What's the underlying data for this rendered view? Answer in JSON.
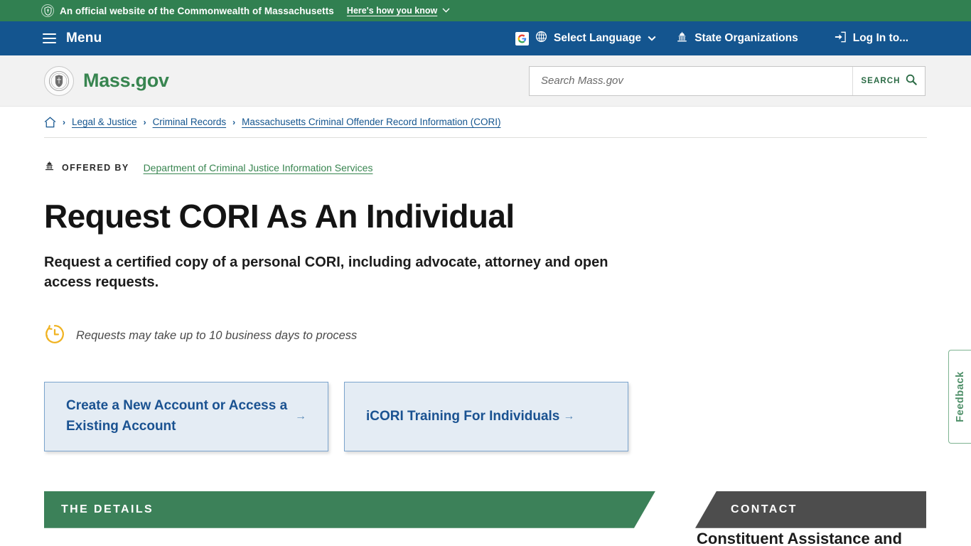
{
  "official_banner": {
    "seal_icon": "state-seal-icon",
    "text": "An official website of the Commonwealth of Massachusetts",
    "how_you_know_label": "Here's how you know",
    "chevron_icon": "chevron-down-icon",
    "background_color": "#318051"
  },
  "main_nav": {
    "menu_icon": "hamburger-icon",
    "menu_label": "Menu",
    "background_color": "#14558f",
    "items": [
      {
        "label": "Select Language",
        "icons": [
          "google-translate-icon",
          "globe-icon"
        ],
        "trailing_icon": "chevron-down-icon"
      },
      {
        "label": "State Organizations",
        "icons": [
          "capitol-dome-icon"
        ]
      },
      {
        "label": "Log In to...",
        "icons": [
          "sign-in-icon"
        ]
      }
    ]
  },
  "header": {
    "logo_seal_icon": "mass-state-seal-icon",
    "wordmark": "Mass.gov",
    "wordmark_color": "#388550",
    "background_color": "#f2f2f2"
  },
  "search": {
    "placeholder": "Search Mass.gov",
    "value": "",
    "button_label": "SEARCH",
    "button_icon": "magnifier-icon"
  },
  "breadcrumb": {
    "home_icon": "home-icon",
    "separator": "›",
    "items": [
      {
        "label": "Legal & Justice"
      },
      {
        "label": "Criminal Records"
      },
      {
        "label": "Massachusetts Criminal Offender Record Information (CORI)"
      }
    ]
  },
  "offered_by": {
    "icon": "capitol-dome-icon",
    "label": "OFFERED BY",
    "organization": "Department of Criminal Justice Information Services",
    "link_color": "#388550"
  },
  "main": {
    "title": "Request CORI As An Individual",
    "lead": "Request a certified copy of a personal CORI, including advocate, attorney and open access requests.",
    "process_note": {
      "icon": "clock-icon",
      "icon_color": "#f0b323",
      "text": "Requests may take up to 10 business days to process"
    },
    "action_cards": [
      {
        "label": "Create a New Account or Access a Existing Account",
        "arrow": "→"
      },
      {
        "label": "iCORI Training For Individuals",
        "arrow": "→"
      }
    ],
    "card_fill_color": "#e4ecf4",
    "card_border_color": "#7ba4cd",
    "card_text_color": "#1a5291"
  },
  "sections": {
    "details": {
      "title": "THE DETAILS",
      "background_color": "#3c8159"
    },
    "contact": {
      "title": "CONTACT",
      "background_color": "#4d4d4d",
      "body_heading": "Constituent Assistance and"
    }
  },
  "feedback": {
    "label": "Feedback",
    "border_color": "#7eb391",
    "text_color": "#4e8f68"
  }
}
